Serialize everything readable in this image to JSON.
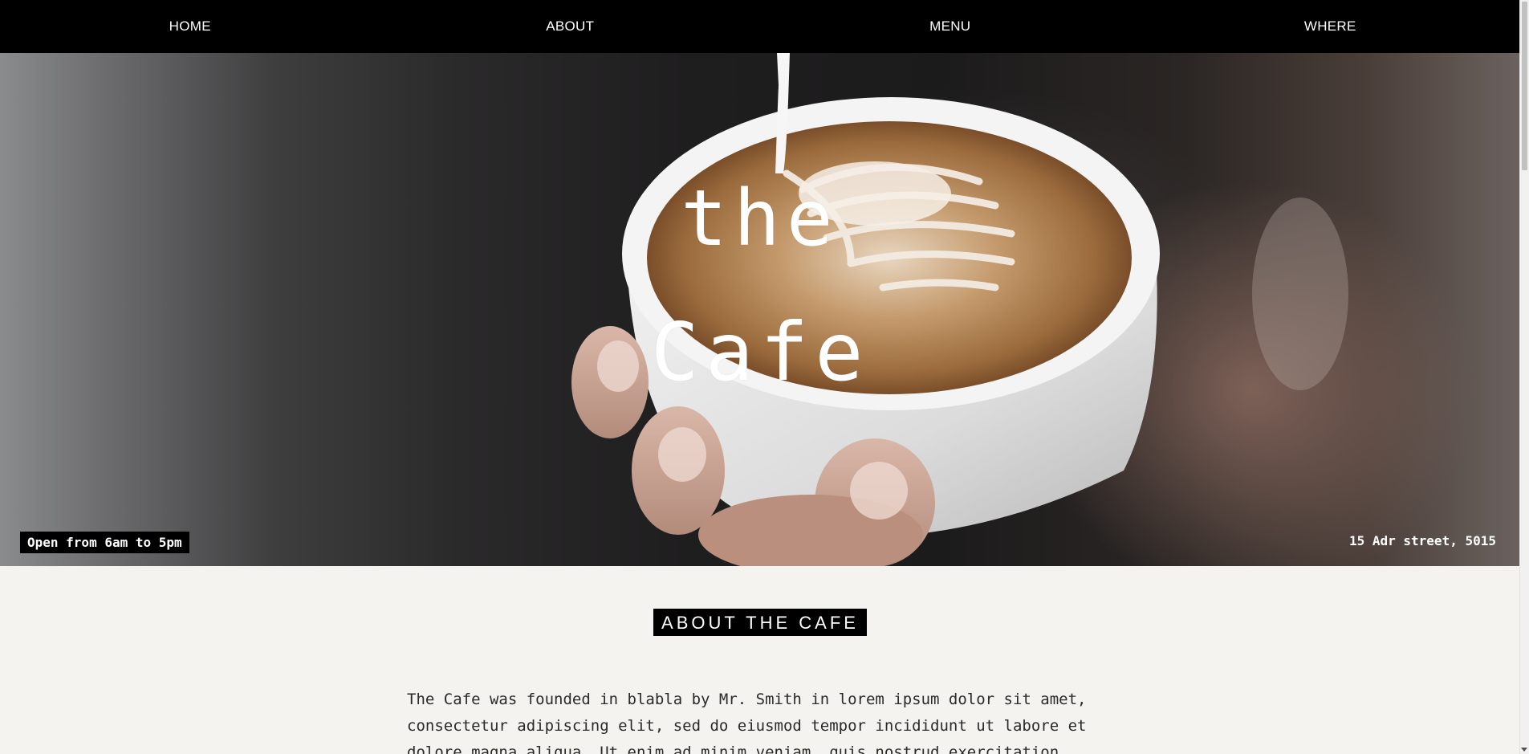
{
  "nav": {
    "items": [
      {
        "label": "HOME"
      },
      {
        "label": "ABOUT"
      },
      {
        "label": "MENU"
      },
      {
        "label": "WHERE"
      }
    ]
  },
  "hero": {
    "title_line1": "the",
    "title_line2": "Cafe",
    "hours": "Open from 6am to 5pm",
    "address": "15 Adr street, 5015",
    "image_subject": "latte art cup held in hands"
  },
  "about": {
    "heading": "ABOUT THE CAFE",
    "body": "The Cafe was founded in blabla by Mr. Smith in lorem ipsum dolor sit amet, consectetur adipiscing elit, sed do eiusmod tempor incididunt ut labore et dolore magna aliqua. Ut enim ad minim veniam, quis nostrud exercitation"
  },
  "colors": {
    "nav_bg": "#000000",
    "page_bg": "#f5f3f0",
    "text": "#2a2a2a"
  }
}
